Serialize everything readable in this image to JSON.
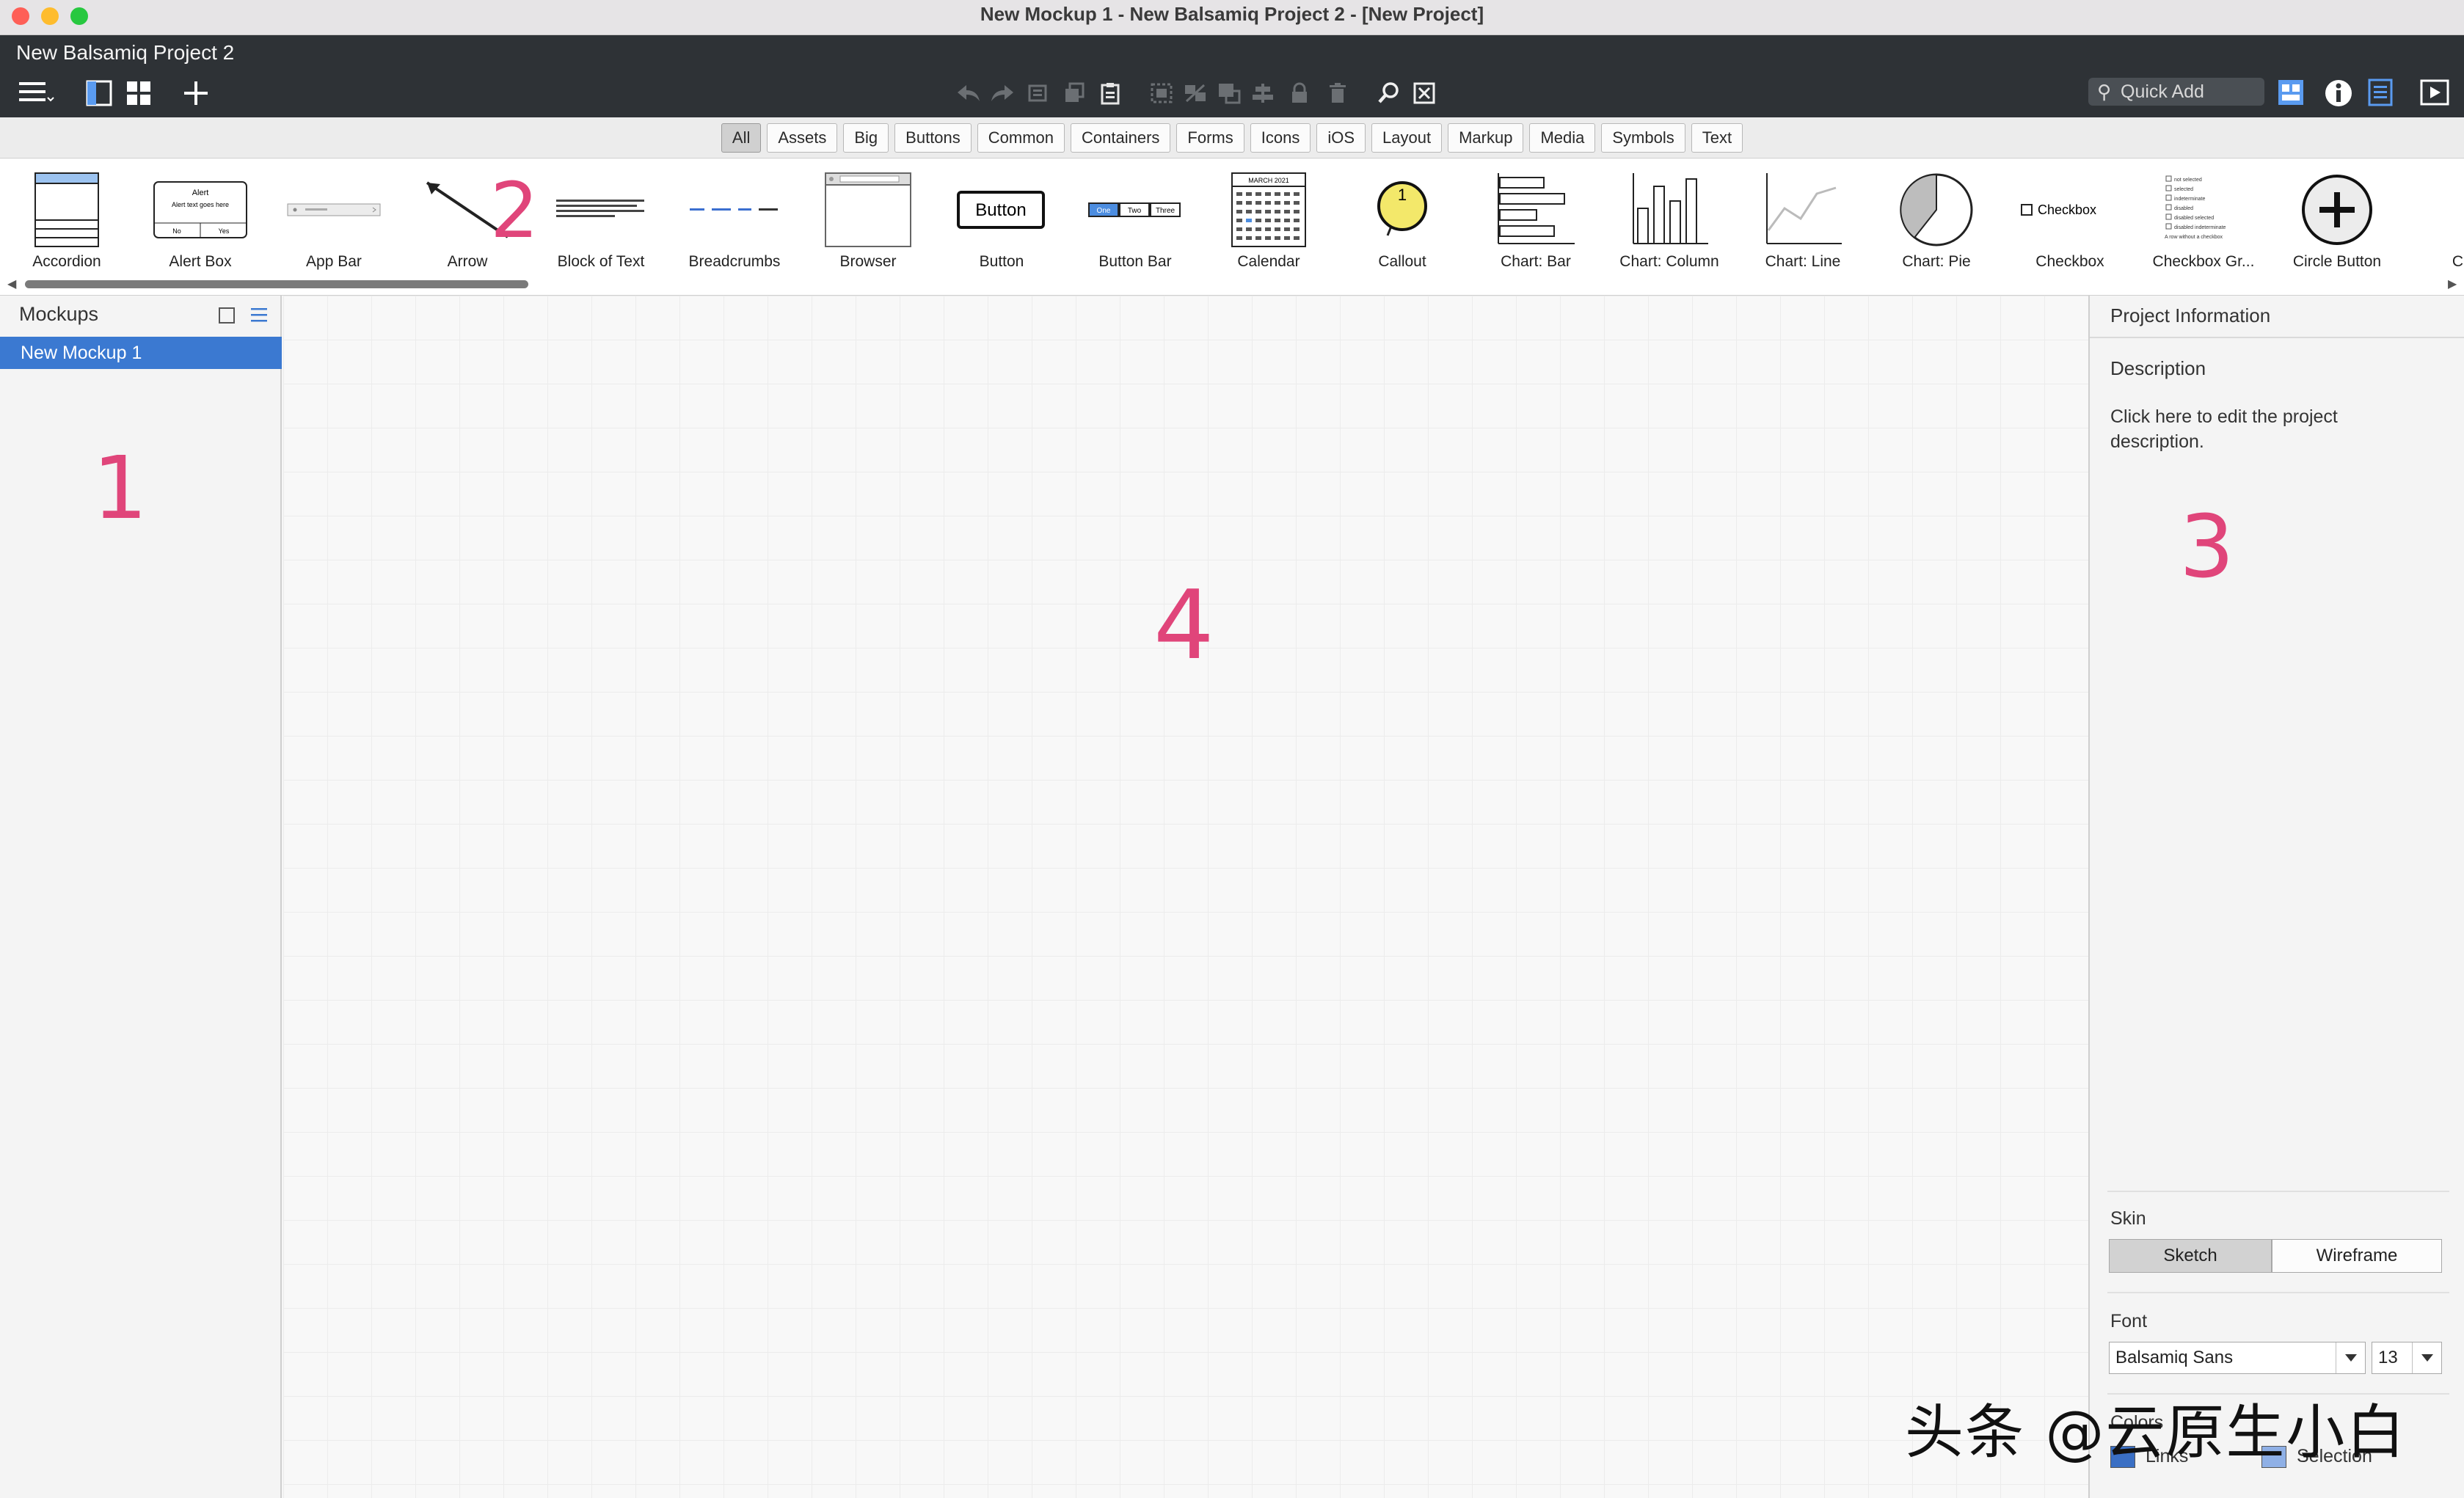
{
  "window": {
    "title": "New Mockup 1 - New Balsamiq Project 2 - [New Project]"
  },
  "appbar": {
    "project_name": "New Balsamiq Project 2",
    "quick_add_placeholder": "Quick Add"
  },
  "filter_tabs": [
    "All",
    "Assets",
    "Big",
    "Buttons",
    "Common",
    "Containers",
    "Forms",
    "Icons",
    "iOS",
    "Layout",
    "Markup",
    "Media",
    "Symbols",
    "Text"
  ],
  "active_filter": "All",
  "library": {
    "items": [
      {
        "label": "Accordion"
      },
      {
        "label": "Alert Box"
      },
      {
        "label": "App Bar"
      },
      {
        "label": "Arrow"
      },
      {
        "label": "Block of Text"
      },
      {
        "label": "Breadcrumbs"
      },
      {
        "label": "Browser"
      },
      {
        "label": "Button"
      },
      {
        "label": "Button Bar"
      },
      {
        "label": "Calendar"
      },
      {
        "label": "Callout"
      },
      {
        "label": "Chart: Bar"
      },
      {
        "label": "Chart: Column"
      },
      {
        "label": "Chart: Line"
      },
      {
        "label": "Chart: Pie"
      },
      {
        "label": "Checkbox"
      },
      {
        "label": "Checkbox Gr..."
      },
      {
        "label": "Circle Button"
      },
      {
        "label": "Color"
      }
    ],
    "thumb_texts": {
      "alert_title": "Alert",
      "alert_body": "Alert text goes here",
      "alert_no": "No",
      "alert_yes": "Yes",
      "button": "Button",
      "buttonbar": [
        "One",
        "Two",
        "Three"
      ],
      "calendar_month": "MARCH 2021",
      "checkbox": "Checkbox",
      "callout": "1",
      "checkbox_group": [
        "not selected",
        "selected",
        "indeterminate",
        "disabled",
        "disabled selected",
        "disabled indeterminate",
        "A row without a checkbox"
      ]
    }
  },
  "mockups_panel": {
    "title": "Mockups",
    "items": [
      "New Mockup 1"
    ]
  },
  "project_info": {
    "title": "Project Information",
    "description_label": "Description",
    "description_text": "Click here to edit the project description.",
    "skin_label": "Skin",
    "skin_options": [
      "Sketch",
      "Wireframe"
    ],
    "active_skin": "Sketch",
    "font_label": "Font",
    "font_family": "Balsamiq Sans",
    "font_size": "13",
    "colors_label": "Colors",
    "color_links_label": "Links",
    "color_selection_label": "Selection",
    "color_links": "#3a6fc4",
    "color_selection": "#8fb0e6"
  },
  "annotations": [
    "1",
    "2",
    "3",
    "4"
  ],
  "watermark": "头条 @云原生小白"
}
